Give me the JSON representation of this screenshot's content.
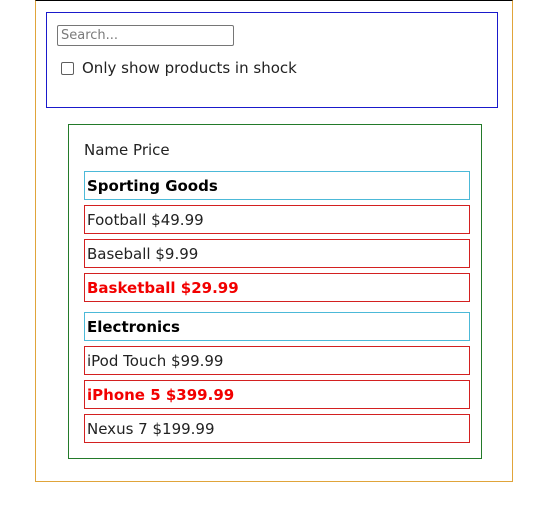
{
  "search": {
    "placeholder": "Search...",
    "value": ""
  },
  "filter": {
    "label": "Only show products in shock",
    "checked": false
  },
  "table": {
    "header_name": "Name",
    "header_price": "Price",
    "categories": [
      {
        "name": "Sporting Goods",
        "products": [
          {
            "name": "Football",
            "price": "$49.99",
            "stocked": true
          },
          {
            "name": "Baseball",
            "price": "$9.99",
            "stocked": true
          },
          {
            "name": "Basketball",
            "price": "$29.99",
            "stocked": false
          }
        ]
      },
      {
        "name": "Electronics",
        "products": [
          {
            "name": "iPod Touch",
            "price": "$99.99",
            "stocked": true
          },
          {
            "name": "iPhone 5",
            "price": "$399.99",
            "stocked": false
          },
          {
            "name": "Nexus 7",
            "price": "$199.99",
            "stocked": true
          }
        ]
      }
    ]
  },
  "colors": {
    "app_border": "#e0a43a",
    "search_bar_border": "#1a1acb",
    "table_border": "#237a2a",
    "category_border": "#4cb9d8",
    "product_border": "#d32020",
    "out_of_stock_text": "#f20000"
  }
}
